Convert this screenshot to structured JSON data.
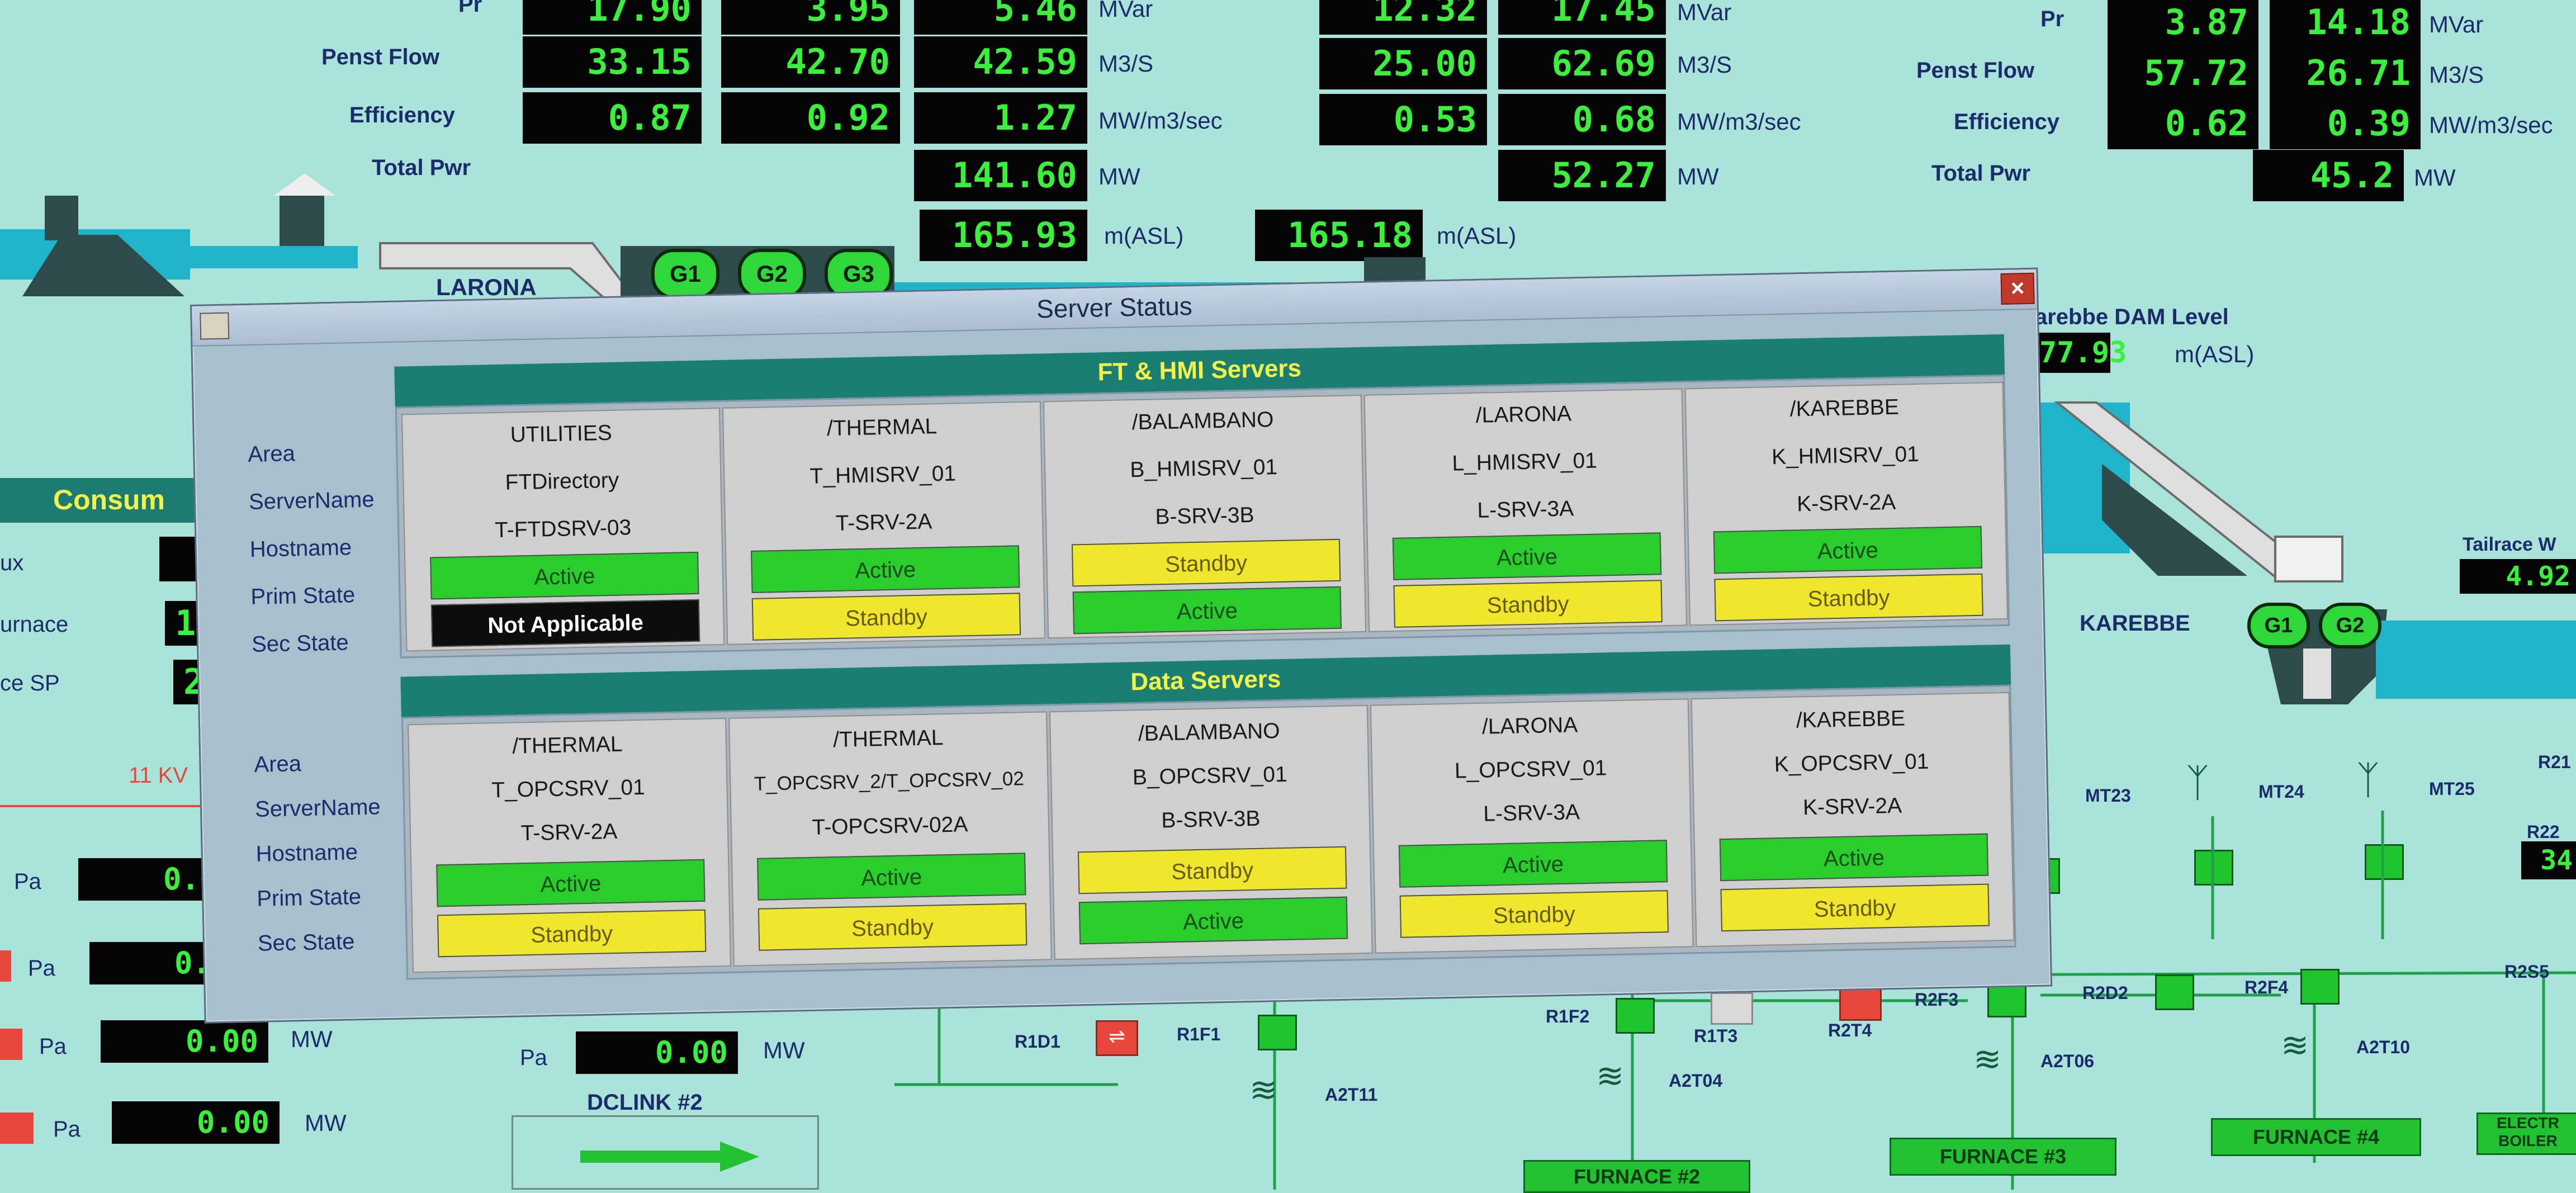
{
  "top_left": {
    "labels": {
      "pr": "Pr",
      "penst_flow": "Penst Flow",
      "efficiency": "Efficiency",
      "total_pwr": "Total Pwr"
    },
    "pr": [
      "17.90",
      "3.95",
      "5.46"
    ],
    "penst_flow": [
      "33.15",
      "42.70",
      "42.59"
    ],
    "efficiency": [
      "0.87",
      "0.92",
      "1.27"
    ],
    "total_pwr": "141.60",
    "level": "165.93",
    "units": {
      "mvar": "MVar",
      "m3s": "M3/S",
      "eff": "MW/m3/sec",
      "mw": "MW",
      "asl": "m(ASL)"
    }
  },
  "top_mid": {
    "pr": [
      "12.32",
      "17.45"
    ],
    "penst_flow": [
      "25.00",
      "62.69"
    ],
    "efficiency": [
      "0.53",
      "0.68"
    ],
    "total_pwr": "52.27",
    "level": "165.18"
  },
  "top_right": {
    "pr": [
      "3.87",
      "14.18"
    ],
    "penst_flow": [
      "57.72",
      "26.71"
    ],
    "efficiency": [
      "0.62",
      "0.39"
    ],
    "total_pwr": "45.2",
    "dam_label": "arebbe DAM Level",
    "dam_level": "77.93",
    "tailrace_label": "Tailrace W",
    "tailrace_value": "4.92"
  },
  "plants": {
    "larona": "LARONA",
    "karebbe": "KAREBBE"
  },
  "generators": {
    "larona": [
      "G1",
      "G2",
      "G3"
    ],
    "karebbe": [
      "G1",
      "G2"
    ]
  },
  "left_panel": {
    "consum_label": "Consum",
    "row_labels": [
      "ux",
      "urnace",
      "ce SP"
    ],
    "row_values": [
      "",
      "1",
      "2"
    ],
    "kv_label": "11 KV",
    "pa_values": [
      "0.00",
      "0.00",
      "0.00",
      "0.00"
    ],
    "pa_label": "Pa",
    "mw_label": "MW",
    "bottom_pa_value": "0.00",
    "dclink": "DCLINK #2"
  },
  "dialog": {
    "title": "Server Status",
    "close": "×",
    "row_labels": [
      "Area",
      "ServerName",
      "Hostname",
      "Prim State",
      "Sec State"
    ],
    "ft_hmi": {
      "header": "FT & HMI Servers",
      "servers": [
        {
          "area": "UTILITIES",
          "server": "FTDirectory",
          "host": "T-FTDSRV-03",
          "prim": "Active",
          "sec": "Not Applicable"
        },
        {
          "area": "/THERMAL",
          "server": "T_HMISRV_01",
          "host": "T-SRV-2A",
          "prim": "Active",
          "sec": "Standby"
        },
        {
          "area": "/BALAMBANO",
          "server": "B_HMISRV_01",
          "host": "B-SRV-3B",
          "prim": "Standby",
          "sec": "Active"
        },
        {
          "area": "/LARONA",
          "server": "L_HMISRV_01",
          "host": "L-SRV-3A",
          "prim": "Active",
          "sec": "Standby"
        },
        {
          "area": "/KAREBBE",
          "server": "K_HMISRV_01",
          "host": "K-SRV-2A",
          "prim": "Active",
          "sec": "Standby"
        }
      ]
    },
    "data": {
      "header": "Data Servers",
      "servers": [
        {
          "area": "/THERMAL",
          "server": "T_OPCSRV_01",
          "host": "T-SRV-2A",
          "prim": "Active",
          "sec": "Standby"
        },
        {
          "area": "/THERMAL",
          "server": "T_OPCSRV_2/T_OPCSRV_02",
          "host": "T-OPCSRV-02A",
          "prim": "Active",
          "sec": "Standby"
        },
        {
          "area": "/BALAMBANO",
          "server": "B_OPCSRV_01",
          "host": "B-SRV-3B",
          "prim": "Standby",
          "sec": "Active"
        },
        {
          "area": "/LARONA",
          "server": "L_OPCSRV_01",
          "host": "L-SRV-3A",
          "prim": "Active",
          "sec": "Standby"
        },
        {
          "area": "/KAREBBE",
          "server": "K_OPCSRV_01",
          "host": "K-SRV-2A",
          "prim": "Active",
          "sec": "Standby"
        }
      ]
    }
  },
  "grid": {
    "transformers": [
      "MT23",
      "MT24",
      "MT25"
    ],
    "r_labels": {
      "r21": "R21",
      "r22": "R22",
      "r2s5": "R2S5",
      "r22_val": "34"
    },
    "switch_labels": [
      "R1D1",
      "R1F1",
      "R1F2",
      "R1T3",
      "R2T4",
      "R2F3",
      "R2D2",
      "R2F4"
    ],
    "transformer_labels": [
      "A2T11",
      "A2T04",
      "A2T06",
      "A2T10"
    ],
    "furnaces": [
      "FURNACE #2",
      "FURNACE #3",
      "FURNACE #4",
      "ELECTR BOILER"
    ]
  },
  "colors": {
    "background": "#a9e3da",
    "value_text": "#39f03a",
    "active": "#29cd2c",
    "standby": "#efe72b",
    "header": "#1a7f72"
  }
}
